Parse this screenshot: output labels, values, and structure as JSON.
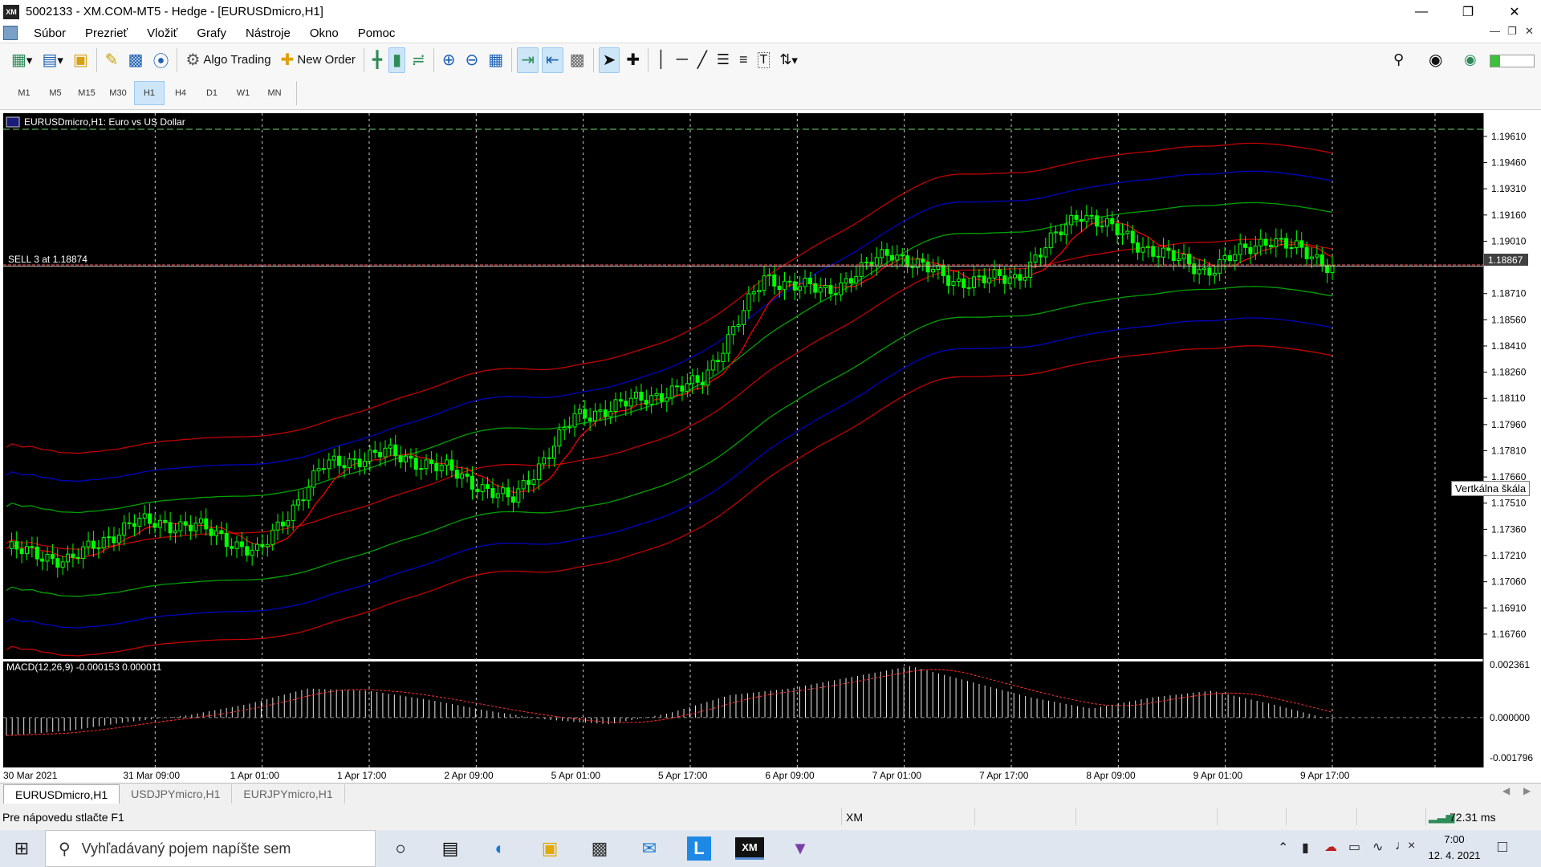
{
  "window": {
    "title": "5002133 - XM.COM-MT5 - Hedge - [EURUSDmicro,H1]",
    "logo": "XM",
    "controls": [
      "minimize-icon",
      "restore-icon",
      "close-icon"
    ]
  },
  "menu": [
    "Súbor",
    "Prezrieť",
    "Vložiť",
    "Grafy",
    "Nástroje",
    "Okno",
    "Pomoc"
  ],
  "toolbar": {
    "algo_trading": "Algo Trading",
    "new_order": "New Order"
  },
  "timeframes": [
    "M1",
    "M5",
    "M15",
    "M30",
    "H1",
    "H4",
    "D1",
    "W1",
    "MN"
  ],
  "timeframe_selected": "H1",
  "chart": {
    "symbol_label": "EURUSDmicro,H1:  Euro vs US Dollar",
    "sell_line_label": "SELL 3 at 1.18874",
    "current_price": "1.18867",
    "price_ticks": [
      "1.19610",
      "1.19460",
      "1.19310",
      "1.19160",
      "1.19010",
      "1.18710",
      "1.18560",
      "1.18410",
      "1.18260",
      "1.18110",
      "1.17960",
      "1.17810",
      "1.17660",
      "1.17510",
      "1.17360",
      "1.17210",
      "1.17060",
      "1.16910",
      "1.16760"
    ],
    "macd_label": "MACD(12,26,9) -0.000153 0.000011",
    "macd_ticks": [
      "0.002361",
      "0.000000",
      "-0.001796"
    ],
    "time_ticks": [
      "30 Mar 2021",
      "31 Mar 09:00",
      "1 Apr 01:00",
      "1 Apr 17:00",
      "2 Apr 09:00",
      "5 Apr 01:00",
      "5 Apr 17:00",
      "6 Apr 09:00",
      "7 Apr 01:00",
      "7 Apr 17:00",
      "8 Apr 09:00",
      "9 Apr 01:00",
      "9 Apr 17:00"
    ],
    "tooltip": "Vertkálna škála",
    "colors": {
      "background": "#000000",
      "candle": "#00ff00",
      "ma_red": "#ff0000",
      "envelope_red": "#c00000",
      "envelope_blue": "#0000c0",
      "envelope_green": "#00a000",
      "sell_line": "#ff4040"
    }
  },
  "chart_data": {
    "type": "candlestick",
    "title": "EURUSDmicro,H1:  Euro vs US Dollar",
    "ylim": [
      1.1664,
      1.1972
    ],
    "x": [
      "30 Mar 2021",
      "31 Mar 09:00",
      "1 Apr 01:00",
      "1 Apr 17:00",
      "2 Apr 09:00",
      "5 Apr 01:00",
      "5 Apr 17:00",
      "6 Apr 09:00",
      "7 Apr 01:00",
      "7 Apr 17:00",
      "8 Apr 09:00",
      "9 Apr 01:00",
      "9 Apr 17:00"
    ],
    "close": [
      1.1725,
      1.1718,
      1.174,
      1.1738,
      1.1722,
      1.1772,
      1.178,
      1.177,
      1.1752,
      1.18,
      1.181,
      1.182,
      1.188,
      1.1872,
      1.1895,
      1.1878,
      1.188,
      1.1918,
      1.1898,
      1.1884,
      1.1903,
      1.1887
    ],
    "sell_price": 1.18874,
    "last_price": 1.18867,
    "macd_ylim": [
      -0.001796,
      0.002361
    ],
    "macd": {
      "value": -0.000153,
      "signal": 1.1e-05,
      "histogram": [
        -0.0008,
        -0.0006,
        -0.0002,
        0.0001,
        0.0006,
        0.0013,
        0.0012,
        0.0008,
        0.0003,
        -0.0001,
        -0.0003,
        0.0002,
        0.001,
        0.0013,
        0.0018,
        0.0023,
        0.0016,
        0.0009,
        0.0004,
        0.0009,
        0.0012,
        0.0006,
        -0.0001
      ]
    }
  },
  "tabs": [
    "EURUSDmicro,H1",
    "USDJPYmicro,H1",
    "EURJPYmicro,H1"
  ],
  "status": {
    "help": "Pre nápovedu stlačte F1",
    "broker": "XM",
    "ping": "72.31 ms"
  },
  "taskbar": {
    "search_placeholder": "Vyhľadávaný pojem napíšte sem",
    "time": "7:00",
    "date": "12. 4. 2021"
  }
}
